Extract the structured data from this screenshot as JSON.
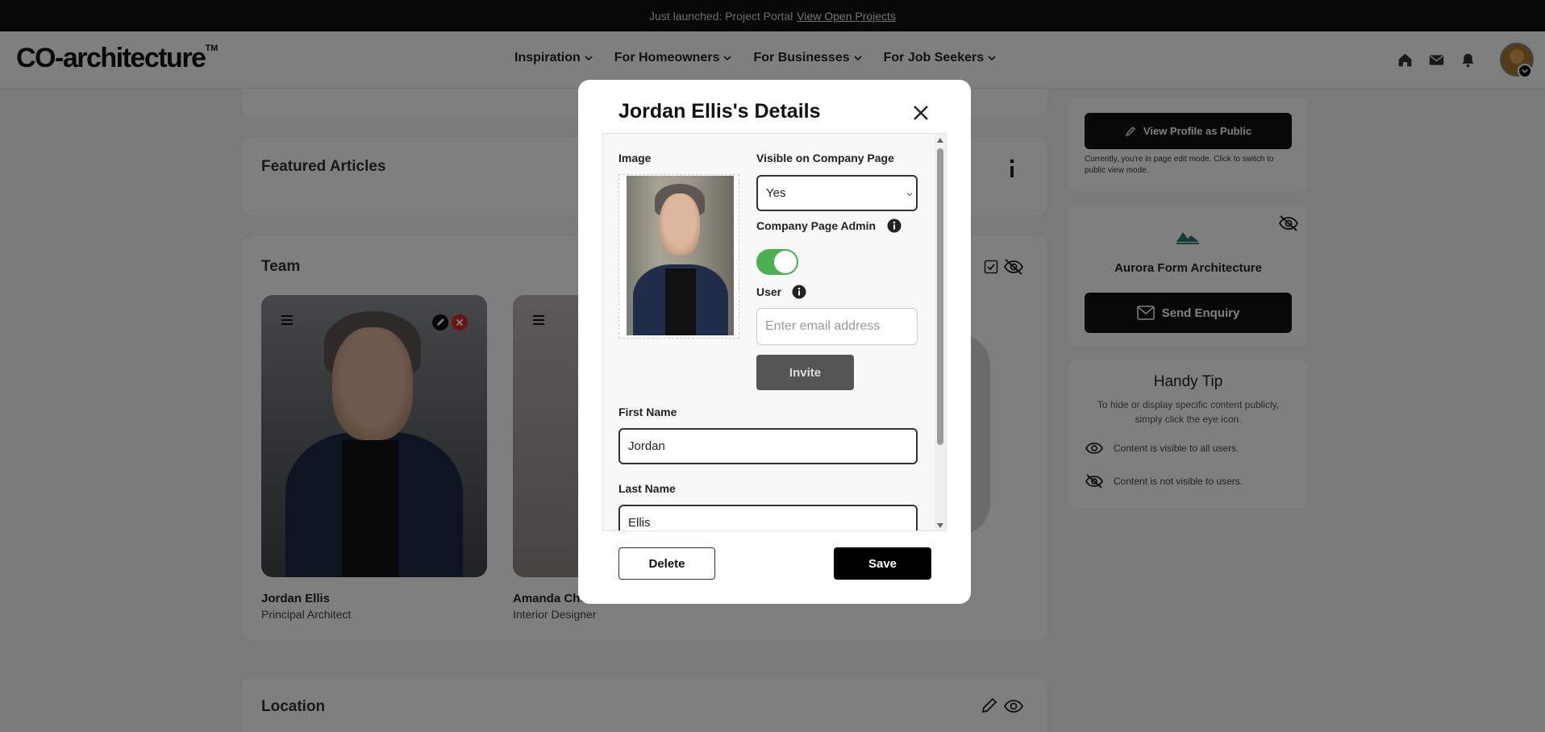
{
  "banner": {
    "text": "Just launched: Project Portal",
    "link": "View Open Projects"
  },
  "header": {
    "logo": "CO-architecture",
    "logo_tm": "TM",
    "nav": [
      "Inspiration",
      "For Homeowners",
      "For Businesses",
      "For Job Seekers"
    ]
  },
  "sections": {
    "featured_articles": "Featured Articles",
    "team": "Team",
    "location": "Location"
  },
  "team": [
    {
      "name": "Jordan Ellis",
      "role": "Principal Architect"
    },
    {
      "name": "Amanda Che",
      "role": "Interior Designer"
    }
  ],
  "sidebar": {
    "view_public_label": "View Profile as Public",
    "edit_mode_note": "Currently, you're in page edit mode. Click to switch to public view mode.",
    "company_name": "Aurora Form Architecture",
    "send_enquiry_label": "Send Enquiry",
    "tip_title": "Handy Tip",
    "tip_text": "To hide or display specific content publicly, simply click the eye icon.",
    "visible_legend": "Content is visible to all users.",
    "hidden_legend": "Content is not visible to users."
  },
  "modal": {
    "title": "Jordan Ellis's Details",
    "image_label": "Image",
    "visible_label": "Visible on Company Page",
    "visible_value": "Yes",
    "admin_label": "Company Page Admin",
    "admin_enabled": true,
    "user_label": "User",
    "email_placeholder": "Enter email address",
    "invite_label": "Invite",
    "first_name_label": "First Name",
    "first_name_value": "Jordan",
    "last_name_label": "Last Name",
    "last_name_value": "Ellis",
    "delete_label": "Delete",
    "save_label": "Save"
  },
  "colors": {
    "toggle_on": "#4caf50",
    "primary": "#000000",
    "overlay": "rgba(0,0,0,0.5)"
  }
}
